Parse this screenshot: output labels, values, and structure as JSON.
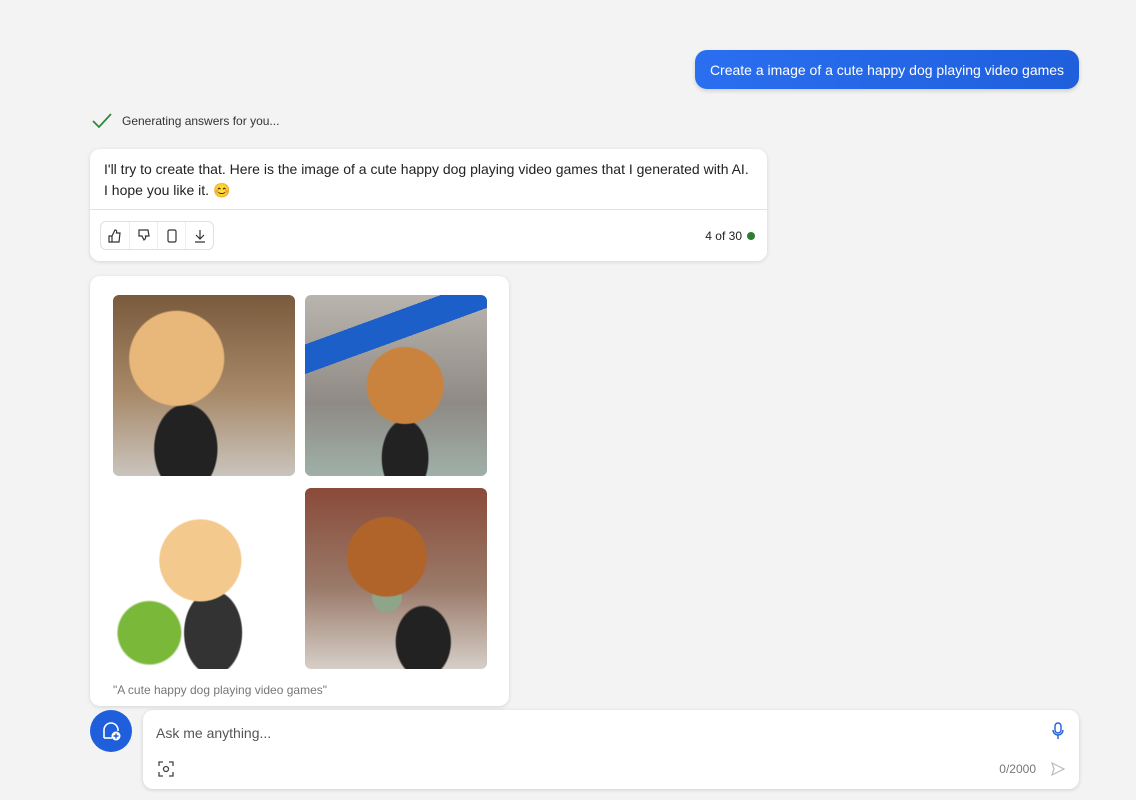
{
  "user_message": "Create a image of a cute happy dog playing video games",
  "status": {
    "text": "Generating answers for you...",
    "icon": "check-icon",
    "color": "#2e8b3a"
  },
  "answer": {
    "text": "I'll try to create that. Here is the image of a cute happy dog playing video games that I generated with AI. I hope you like it. 😊",
    "actions": [
      "thumbs-up-icon",
      "thumbs-down-icon",
      "copy-icon",
      "download-icon"
    ],
    "count": "4 of 30"
  },
  "images": {
    "items": [
      "dog-photo-1",
      "dog-photo-graduation-cap",
      "dog-cartoon",
      "dog-photo-bowtie"
    ],
    "caption": "\"A cute happy dog playing video games\""
  },
  "composer": {
    "placeholder": "Ask me anything...",
    "char_count": "0/2000"
  },
  "colors": {
    "accent": "#1f5fdc",
    "background": "#f3f3f3"
  }
}
